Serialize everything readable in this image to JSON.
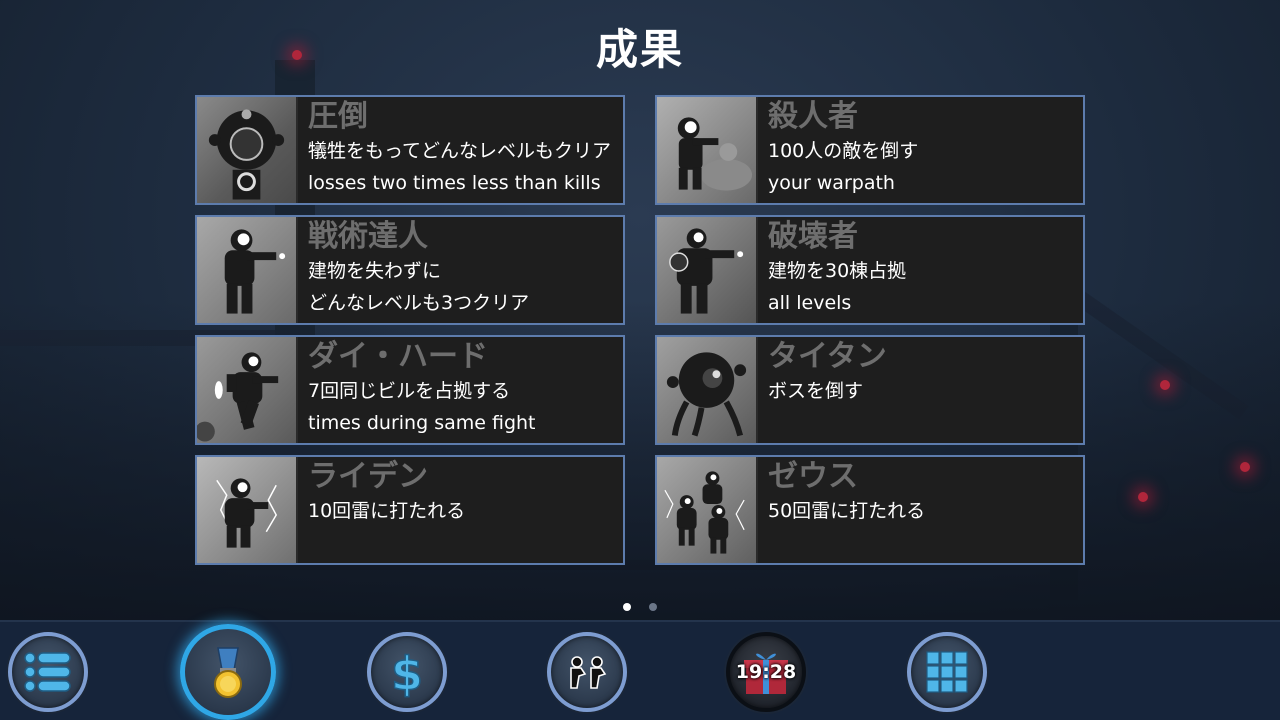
{
  "screen_title": "成果",
  "achievements": [
    {
      "name": "圧倒",
      "lines": [
        "犠牲をもってどんなレベルもクリア",
        "losses two times less than kills"
      ],
      "icon": "overwhelm-icon"
    },
    {
      "name": "殺人者",
      "lines": [
        "100人の敵を倒す",
        "your warpath"
      ],
      "icon": "killer-icon"
    },
    {
      "name": "戦術達人",
      "lines": [
        "建物を失わずに",
        "どんなレベルも3つクリア"
      ],
      "icon": "tactician-icon"
    },
    {
      "name": "破壊者",
      "lines": [
        "建物を30棟占拠",
        "all levels"
      ],
      "icon": "destroyer-icon"
    },
    {
      "name": "ダイ・ハード",
      "lines": [
        "7回同じビルを占拠する",
        "times during same fight"
      ],
      "icon": "die-hard-icon"
    },
    {
      "name": "タイタン",
      "lines": [
        "ボスを倒す",
        ""
      ],
      "icon": "titan-icon"
    },
    {
      "name": "ライデン",
      "lines": [
        "10回雷に打たれる",
        ""
      ],
      "icon": "raiden-icon"
    },
    {
      "name": "ゼウス",
      "lines": [
        "50回雷に打たれる",
        ""
      ],
      "icon": "zeus-icon"
    }
  ],
  "pagination": {
    "pages": 2,
    "current": 1
  },
  "bottom_nav": [
    {
      "name": "menu",
      "icon": "list-menu-icon",
      "active": false
    },
    {
      "name": "achievements",
      "icon": "medal-icon",
      "active": true
    },
    {
      "name": "shop",
      "icon": "dollar-icon",
      "active": false
    },
    {
      "name": "soldiers",
      "icon": "soldiers-icon",
      "active": false
    },
    {
      "name": "gift",
      "icon": "gift-icon",
      "active": false,
      "timer": "19:28"
    },
    {
      "name": "levels",
      "icon": "grid-icon",
      "active": false
    }
  ],
  "colors": {
    "card_border": "#5d7cad",
    "active_ring": "#2fa7e6",
    "nav_ring": "#7e9dd1",
    "achievement_name": "#6e6e6e"
  }
}
